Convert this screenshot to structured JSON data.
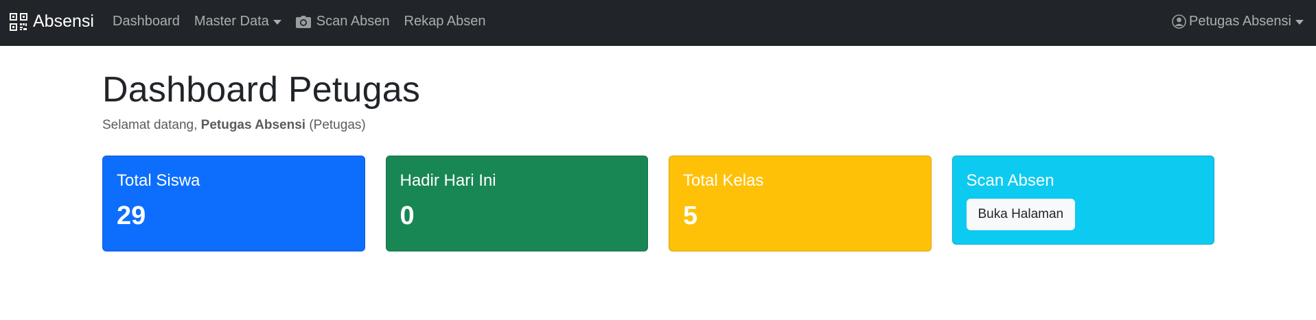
{
  "navbar": {
    "brand": "Absensi",
    "links": [
      {
        "label": "Dashboard"
      },
      {
        "label": "Master Data",
        "dropdown": true
      },
      {
        "label": "Scan Absen",
        "icon": "camera-icon"
      },
      {
        "label": "Rekap Absen"
      }
    ],
    "user": "Petugas Absensi"
  },
  "main": {
    "title": "Dashboard Petugas",
    "welcome_prefix": "Selamat datang, ",
    "welcome_name": "Petugas Absensi",
    "welcome_role": " (Petugas)"
  },
  "cards": [
    {
      "title": "Total Siswa",
      "value": "29",
      "color": "#0d6efd"
    },
    {
      "title": "Hadir Hari Ini",
      "value": "0",
      "color": "#198754"
    },
    {
      "title": "Total Kelas",
      "value": "5",
      "color": "#ffc107"
    },
    {
      "title": "Scan Absen",
      "button": "Buka Halaman",
      "color": "#0dcaf0"
    }
  ],
  "colors": {
    "navbar_bg": "#212529",
    "nav_text": "#9a9da0"
  }
}
